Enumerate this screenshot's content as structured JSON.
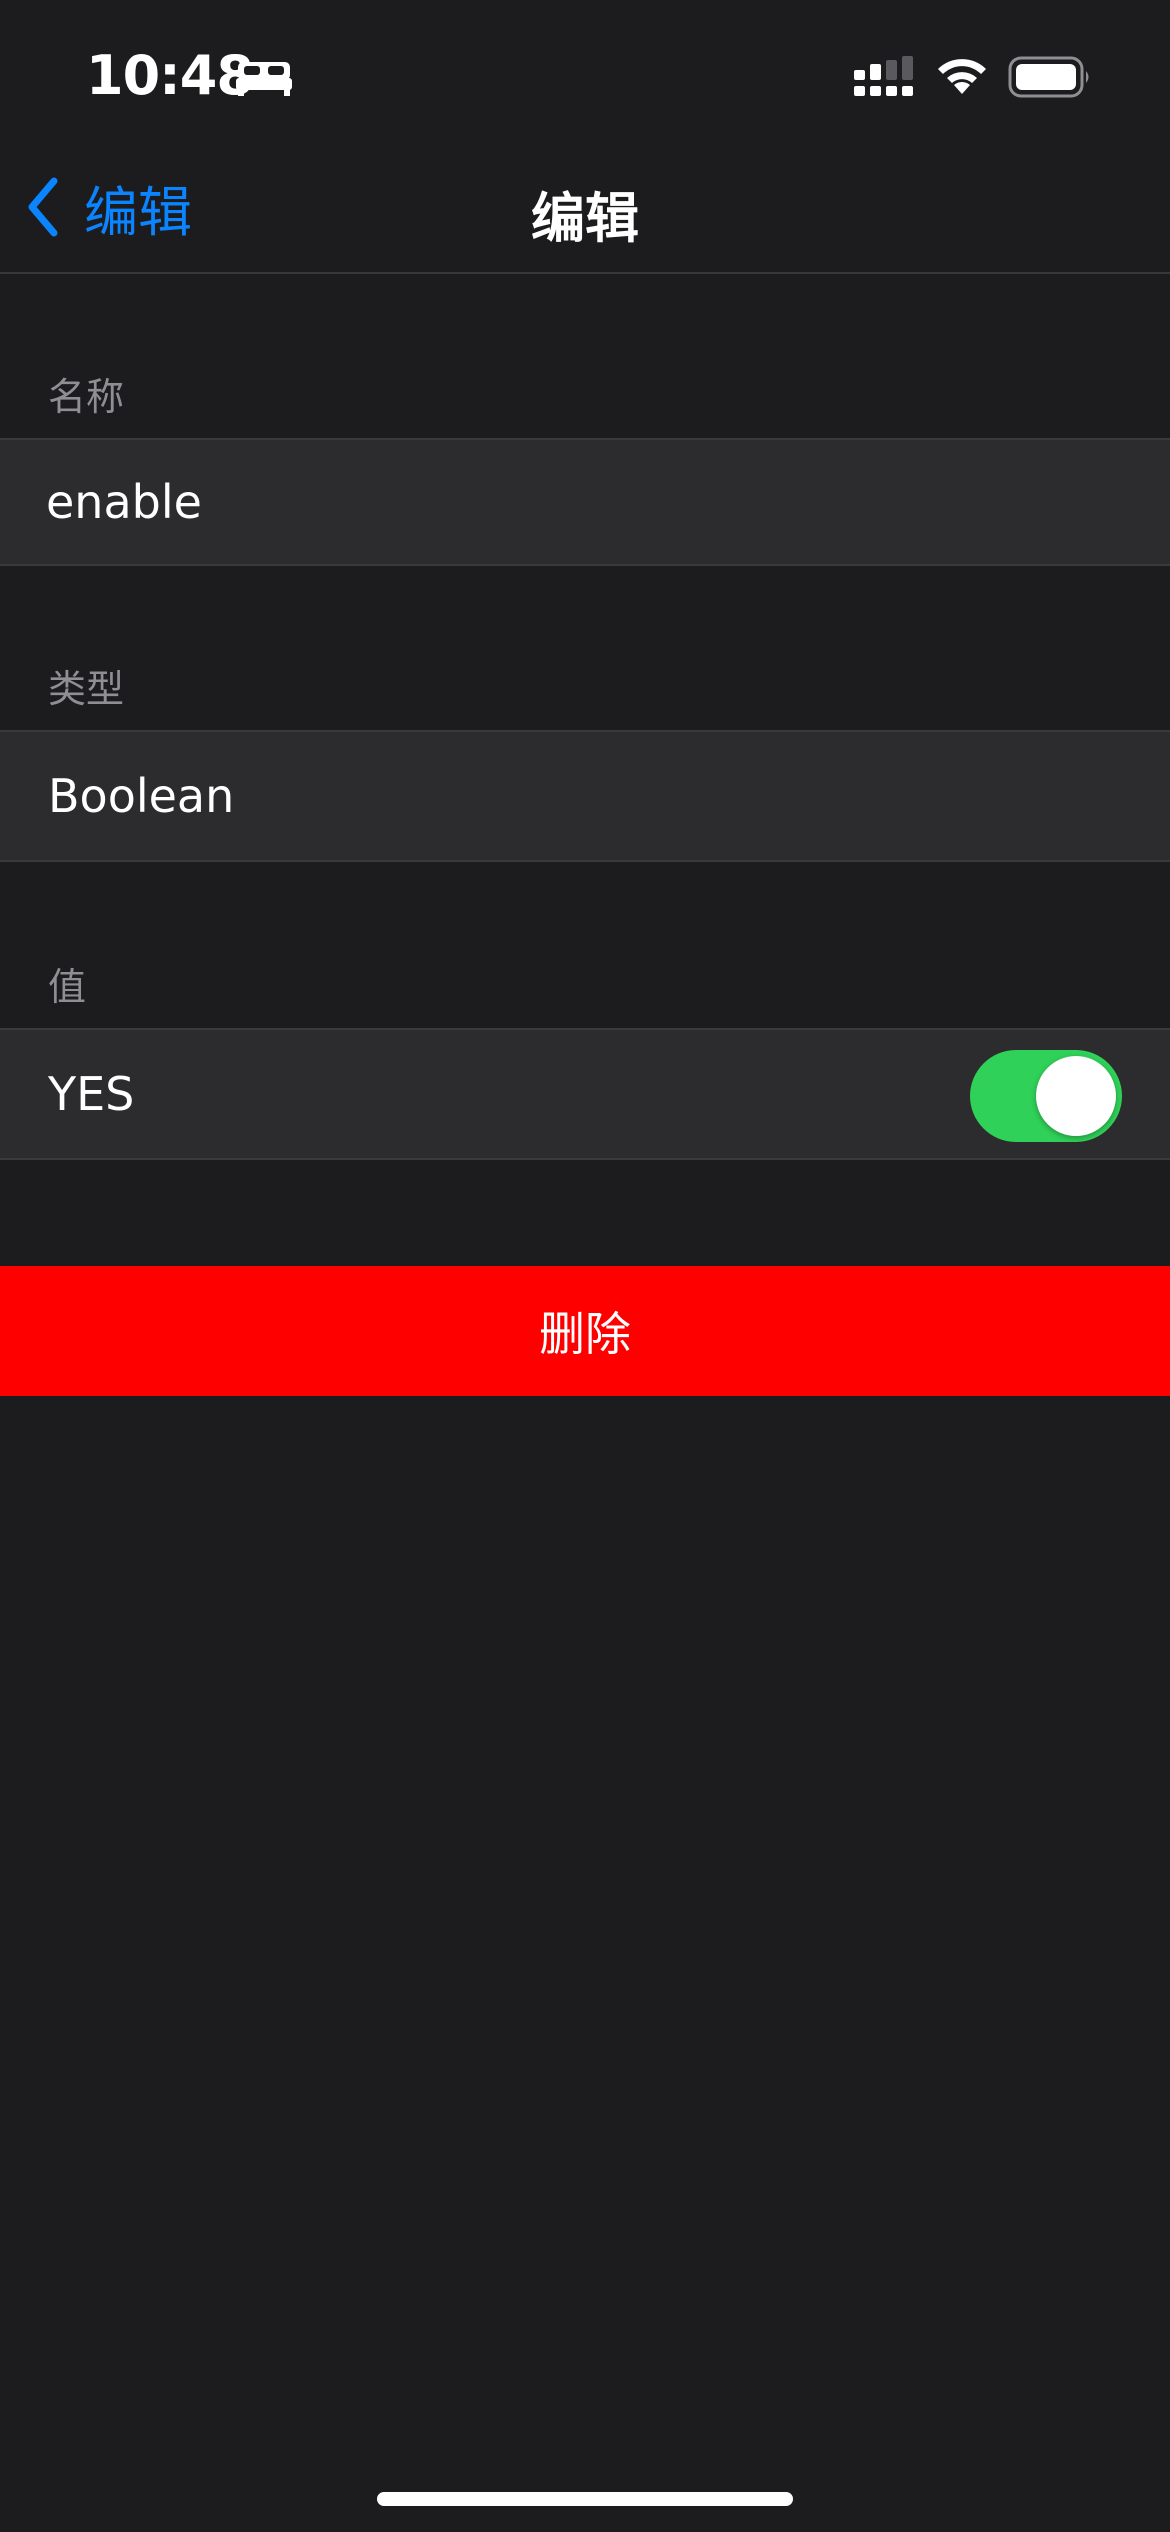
{
  "status_bar": {
    "time": "10:48",
    "sleep_icon": "bed-icon",
    "signal_icon": "cellular-signal-icon",
    "wifi_icon": "wifi-icon",
    "battery_icon": "battery-icon"
  },
  "nav": {
    "back_label": "编辑",
    "title": "编辑"
  },
  "fields": {
    "name": {
      "header": "名称",
      "value": "enable"
    },
    "type": {
      "header": "类型",
      "value": "Boolean"
    },
    "value": {
      "header": "值",
      "label": "YES",
      "toggle_on": true
    }
  },
  "delete_label": "删除",
  "colors": {
    "background": "#1c1c1e",
    "cell": "#2c2c2e",
    "accent": "#0a84ff",
    "toggle_on": "#30d158",
    "destructive": "#ff0000",
    "secondary_text": "#8e8e93"
  }
}
